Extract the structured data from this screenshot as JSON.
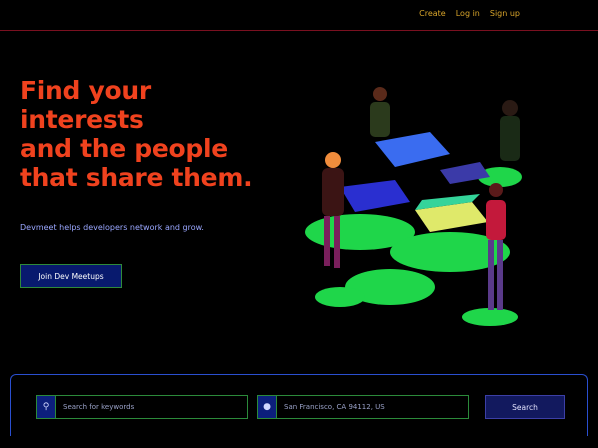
{
  "nav": {
    "items": [
      {
        "label": "Create"
      },
      {
        "label": "Log in"
      },
      {
        "label": "Sign up"
      }
    ]
  },
  "hero": {
    "title_lines": [
      "Find your",
      "interests",
      "and the people",
      "that share them."
    ],
    "subtitle": "Devmeet helps developers network and grow.",
    "cta_label": "Join Dev Meetups",
    "accent_color": "#f0421e"
  },
  "search": {
    "topic_icon": "search-icon",
    "topic_value": "Search for keywords",
    "location_icon": "location-pin-icon",
    "location_value": "San Francisco, CA 94112, US",
    "button_label": "Search"
  }
}
